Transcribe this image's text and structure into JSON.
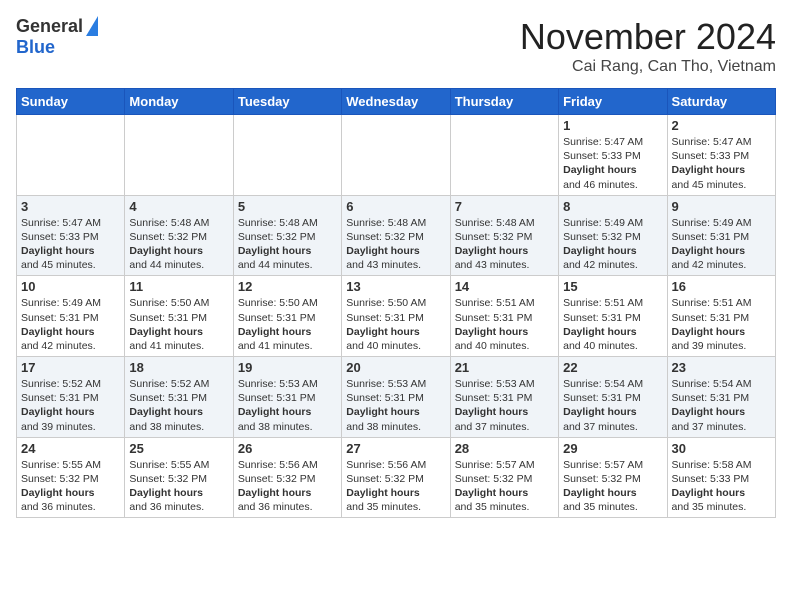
{
  "header": {
    "logo_general": "General",
    "logo_blue": "Blue",
    "month_title": "November 2024",
    "location": "Cai Rang, Can Tho, Vietnam"
  },
  "calendar": {
    "days_of_week": [
      "Sunday",
      "Monday",
      "Tuesday",
      "Wednesday",
      "Thursday",
      "Friday",
      "Saturday"
    ],
    "weeks": [
      [
        {
          "day": "",
          "info": ""
        },
        {
          "day": "",
          "info": ""
        },
        {
          "day": "",
          "info": ""
        },
        {
          "day": "",
          "info": ""
        },
        {
          "day": "",
          "info": ""
        },
        {
          "day": "1",
          "info": "Sunrise: 5:47 AM\nSunset: 5:33 PM\nDaylight: 11 hours and 46 minutes."
        },
        {
          "day": "2",
          "info": "Sunrise: 5:47 AM\nSunset: 5:33 PM\nDaylight: 11 hours and 45 minutes."
        }
      ],
      [
        {
          "day": "3",
          "info": "Sunrise: 5:47 AM\nSunset: 5:33 PM\nDaylight: 11 hours and 45 minutes."
        },
        {
          "day": "4",
          "info": "Sunrise: 5:48 AM\nSunset: 5:32 PM\nDaylight: 11 hours and 44 minutes."
        },
        {
          "day": "5",
          "info": "Sunrise: 5:48 AM\nSunset: 5:32 PM\nDaylight: 11 hours and 44 minutes."
        },
        {
          "day": "6",
          "info": "Sunrise: 5:48 AM\nSunset: 5:32 PM\nDaylight: 11 hours and 43 minutes."
        },
        {
          "day": "7",
          "info": "Sunrise: 5:48 AM\nSunset: 5:32 PM\nDaylight: 11 hours and 43 minutes."
        },
        {
          "day": "8",
          "info": "Sunrise: 5:49 AM\nSunset: 5:32 PM\nDaylight: 11 hours and 42 minutes."
        },
        {
          "day": "9",
          "info": "Sunrise: 5:49 AM\nSunset: 5:31 PM\nDaylight: 11 hours and 42 minutes."
        }
      ],
      [
        {
          "day": "10",
          "info": "Sunrise: 5:49 AM\nSunset: 5:31 PM\nDaylight: 11 hours and 42 minutes."
        },
        {
          "day": "11",
          "info": "Sunrise: 5:50 AM\nSunset: 5:31 PM\nDaylight: 11 hours and 41 minutes."
        },
        {
          "day": "12",
          "info": "Sunrise: 5:50 AM\nSunset: 5:31 PM\nDaylight: 11 hours and 41 minutes."
        },
        {
          "day": "13",
          "info": "Sunrise: 5:50 AM\nSunset: 5:31 PM\nDaylight: 11 hours and 40 minutes."
        },
        {
          "day": "14",
          "info": "Sunrise: 5:51 AM\nSunset: 5:31 PM\nDaylight: 11 hours and 40 minutes."
        },
        {
          "day": "15",
          "info": "Sunrise: 5:51 AM\nSunset: 5:31 PM\nDaylight: 11 hours and 40 minutes."
        },
        {
          "day": "16",
          "info": "Sunrise: 5:51 AM\nSunset: 5:31 PM\nDaylight: 11 hours and 39 minutes."
        }
      ],
      [
        {
          "day": "17",
          "info": "Sunrise: 5:52 AM\nSunset: 5:31 PM\nDaylight: 11 hours and 39 minutes."
        },
        {
          "day": "18",
          "info": "Sunrise: 5:52 AM\nSunset: 5:31 PM\nDaylight: 11 hours and 38 minutes."
        },
        {
          "day": "19",
          "info": "Sunrise: 5:53 AM\nSunset: 5:31 PM\nDaylight: 11 hours and 38 minutes."
        },
        {
          "day": "20",
          "info": "Sunrise: 5:53 AM\nSunset: 5:31 PM\nDaylight: 11 hours and 38 minutes."
        },
        {
          "day": "21",
          "info": "Sunrise: 5:53 AM\nSunset: 5:31 PM\nDaylight: 11 hours and 37 minutes."
        },
        {
          "day": "22",
          "info": "Sunrise: 5:54 AM\nSunset: 5:31 PM\nDaylight: 11 hours and 37 minutes."
        },
        {
          "day": "23",
          "info": "Sunrise: 5:54 AM\nSunset: 5:31 PM\nDaylight: 11 hours and 37 minutes."
        }
      ],
      [
        {
          "day": "24",
          "info": "Sunrise: 5:55 AM\nSunset: 5:32 PM\nDaylight: 11 hours and 36 minutes."
        },
        {
          "day": "25",
          "info": "Sunrise: 5:55 AM\nSunset: 5:32 PM\nDaylight: 11 hours and 36 minutes."
        },
        {
          "day": "26",
          "info": "Sunrise: 5:56 AM\nSunset: 5:32 PM\nDaylight: 11 hours and 36 minutes."
        },
        {
          "day": "27",
          "info": "Sunrise: 5:56 AM\nSunset: 5:32 PM\nDaylight: 11 hours and 35 minutes."
        },
        {
          "day": "28",
          "info": "Sunrise: 5:57 AM\nSunset: 5:32 PM\nDaylight: 11 hours and 35 minutes."
        },
        {
          "day": "29",
          "info": "Sunrise: 5:57 AM\nSunset: 5:32 PM\nDaylight: 11 hours and 35 minutes."
        },
        {
          "day": "30",
          "info": "Sunrise: 5:58 AM\nSunset: 5:33 PM\nDaylight: 11 hours and 35 minutes."
        }
      ]
    ]
  }
}
